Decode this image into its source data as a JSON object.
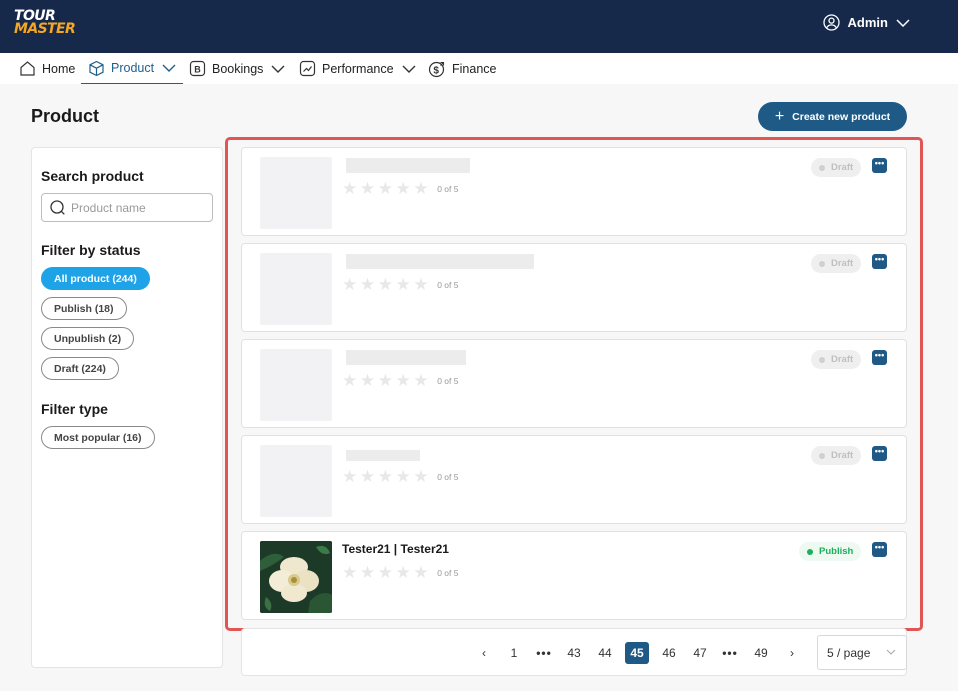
{
  "app": {
    "logo_top": "TOUR",
    "logo_bottom": "MASTER",
    "user": "Admin"
  },
  "nav": {
    "home": "Home",
    "product": "Product",
    "bookings": "Bookings",
    "performance": "Performance",
    "finance": "Finance"
  },
  "page": {
    "title": "Product",
    "create_label": "Create new product"
  },
  "sidebar": {
    "search_heading": "Search product",
    "search_placeholder": "Product name",
    "status_heading": "Filter by status",
    "status_filters": [
      "All product (244)",
      "Publish (18)",
      "Unpublish (2)",
      "Draft (224)"
    ],
    "active_status": "All product (244)",
    "type_heading": "Filter type",
    "type_filters": [
      "Most popular (16)"
    ]
  },
  "products": [
    {
      "title": "",
      "rating_text": "0 of 5",
      "status": "Draft",
      "more": "•••"
    },
    {
      "title": "",
      "rating_text": "0 of 5",
      "status": "Draft",
      "more": "•••"
    },
    {
      "title": "",
      "rating_text": "0 of 5",
      "status": "Draft",
      "more": "•••"
    },
    {
      "title": "",
      "rating_text": "0 of 5",
      "status": "Draft",
      "more": "•••"
    },
    {
      "title": "Tester21 | Tester21",
      "rating_text": "0 of 5",
      "status": "Publish",
      "more": "•••"
    }
  ],
  "pagination": {
    "prev": "‹",
    "next": "›",
    "pages": [
      "1",
      "•••",
      "43",
      "44",
      "45",
      "46",
      "47",
      "•••",
      "49"
    ],
    "current": "45",
    "page_size": "5 / page"
  },
  "colors": {
    "header_bg": "#17294a",
    "primary": "#1f5a86",
    "active_chip": "#1ea2e8",
    "highlight_border": "#e25555",
    "publish_green": "#19b15a"
  }
}
